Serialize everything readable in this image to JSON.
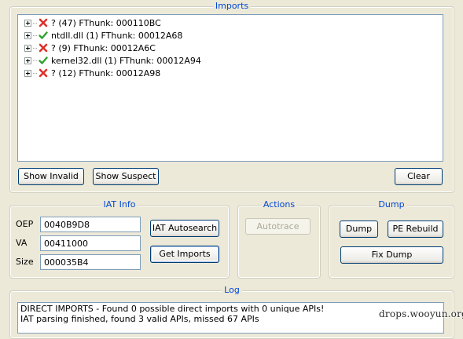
{
  "imports": {
    "title": "Imports",
    "rows": [
      {
        "status": "invalid",
        "icon": "red-x-icon",
        "label": "? (47) FThunk: 000110BC"
      },
      {
        "status": "valid",
        "icon": "green-check-icon",
        "label": "ntdll.dll (1) FThunk: 00012A68"
      },
      {
        "status": "invalid",
        "icon": "red-x-icon",
        "label": "? (9) FThunk: 00012A6C"
      },
      {
        "status": "valid",
        "icon": "green-check-icon",
        "label": "kernel32.dll (1) FThunk: 00012A94"
      },
      {
        "status": "invalid",
        "icon": "red-x-icon",
        "label": "? (12) FThunk: 00012A98"
      }
    ],
    "show_invalid_label": "Show Invalid",
    "show_suspect_label": "Show Suspect",
    "clear_label": "Clear"
  },
  "iat_info": {
    "title": "IAT Info",
    "oep_label": "OEP",
    "oep_value": "0040B9D8",
    "va_label": "VA",
    "va_value": "00411000",
    "size_label": "Size",
    "size_value": "000035B4",
    "autosearch_label": "IAT Autosearch",
    "get_imports_label": "Get Imports"
  },
  "actions": {
    "title": "Actions",
    "autotrace_label": "Autotrace"
  },
  "dump": {
    "title": "Dump",
    "dump_label": "Dump",
    "pe_rebuild_label": "PE Rebuild",
    "fix_dump_label": "Fix Dump"
  },
  "log": {
    "title": "Log",
    "lines": [
      "DIRECT IMPORTS - Found 0 possible direct imports with 0 unique APIs!",
      "IAT parsing finished, found 3 valid APIs, missed 67 APIs"
    ]
  },
  "watermark": "drops.wooyun.org",
  "colors": {
    "window_bg": "#ece9d8",
    "legend_text": "#0046d5",
    "invalid": "#e0302a",
    "valid": "#2fa02f"
  }
}
